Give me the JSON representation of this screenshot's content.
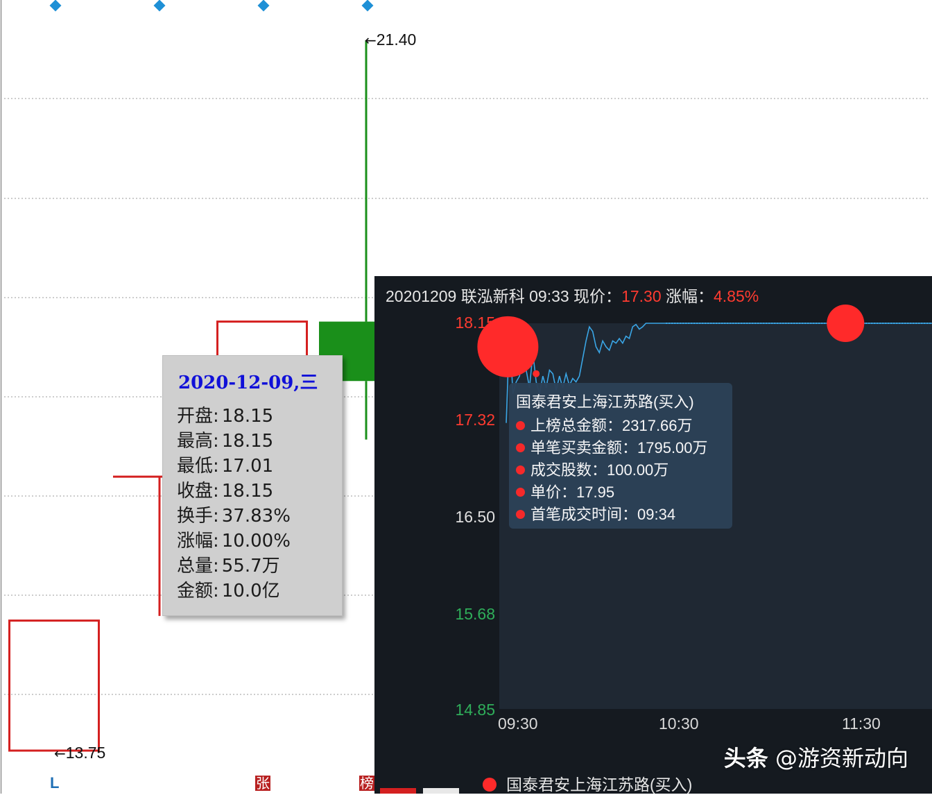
{
  "kline": {
    "chart_data": {
      "type": "candlestick",
      "candles": [
        {
          "name": "candle-1",
          "open": 13.75,
          "close": 15.15,
          "high": 15.15,
          "low": 13.75,
          "color": "#d42020",
          "style": "hollow"
        },
        {
          "name": "candle-2",
          "open": 16.7,
          "close": 16.7,
          "high": 16.7,
          "low": 15.2,
          "color": "#d42020",
          "style": "doji"
        },
        {
          "name": "candle-3",
          "open": 16.9,
          "close": 18.37,
          "high": 18.37,
          "low": 16.7,
          "color": "#d42020",
          "style": "hollow"
        },
        {
          "name": "candle-4",
          "open": 18.37,
          "close": 17.73,
          "high": 21.4,
          "low": 17.1,
          "color": "#1a8f1a",
          "style": "filled"
        }
      ],
      "annotations": {
        "high_label": "21.40",
        "low_label": "13.75"
      },
      "grid": true
    },
    "markers": [
      "张",
      "榜"
    ],
    "bottom_label": "L"
  },
  "ohlc_tooltip": {
    "date": "2020-12-09,三",
    "rows": [
      {
        "label": "开盘:",
        "value": "18.15"
      },
      {
        "label": "最高:",
        "value": "18.15"
      },
      {
        "label": "最低:",
        "value": "17.01"
      },
      {
        "label": "收盘:",
        "value": "18.15"
      },
      {
        "label": "换手:",
        "value": "37.83%"
      },
      {
        "label": "涨幅:",
        "value": "10.00%"
      },
      {
        "label": "总量:",
        "value": "55.7万"
      },
      {
        "label": "金额:",
        "value": "10.0亿"
      }
    ]
  },
  "intraday": {
    "title_prefix": "20201209 联泓新科 09:33 现价：",
    "price": "17.30",
    "change_label": " 涨幅：",
    "change": "4.85%",
    "chart_data": {
      "type": "line",
      "y_ticks": [
        "18.15",
        "17.32",
        "16.50",
        "15.68",
        "14.85"
      ],
      "y_tick_colors": [
        "#ff3b30",
        "#ff3b30",
        "#e0e0e0",
        "#2fae5a",
        "#2fae5a"
      ],
      "ylim": [
        14.85,
        18.15
      ],
      "x_ticks": [
        "09:30",
        "10:30",
        "11:30"
      ],
      "x_minutes": [
        0,
        60,
        120
      ],
      "xlim": [
        0,
        128
      ],
      "line_color": "#3aa6e6",
      "series": [
        {
          "x": [
            0,
            1,
            2,
            3,
            4,
            5,
            6,
            7,
            8,
            9,
            10,
            11,
            12,
            13,
            14,
            15,
            16,
            17,
            18,
            19,
            20,
            21,
            22,
            23,
            24,
            25,
            26,
            27,
            28,
            29,
            30,
            31,
            32,
            33,
            34,
            35,
            36,
            37,
            38,
            39,
            40,
            41,
            42,
            43,
            44,
            45,
            46,
            47,
            48,
            50,
            52,
            54,
            56,
            58,
            60,
            65,
            70,
            75,
            80,
            85,
            90,
            95,
            100,
            105,
            110,
            115,
            120,
            125,
            128
          ],
          "y": [
            17.3,
            18.1,
            17.55,
            17.65,
            17.7,
            17.85,
            17.75,
            17.6,
            17.9,
            17.65,
            17.55,
            17.7,
            17.6,
            17.75,
            17.72,
            17.58,
            17.7,
            17.6,
            17.72,
            17.62,
            17.68,
            17.65,
            17.7,
            17.85,
            18.0,
            18.12,
            18.08,
            17.95,
            17.9,
            18.0,
            17.95,
            17.92,
            18.0,
            17.98,
            18.02,
            17.98,
            18.04,
            18.02,
            18.12,
            18.14,
            18.1,
            18.12,
            18.15,
            18.15,
            18.15,
            18.15,
            18.15,
            18.15,
            18.15,
            18.15,
            18.15,
            18.15,
            18.15,
            18.15,
            18.15,
            18.15,
            18.15,
            18.15,
            18.15,
            18.15,
            18.15,
            18.15,
            18.15,
            18.15,
            18.15,
            18.15,
            18.15,
            18.15,
            18.15
          ]
        }
      ],
      "bubbles": [
        {
          "x": 0.5,
          "y": 17.95,
          "size": "large"
        },
        {
          "x": 102,
          "y": 18.15,
          "size": "medium"
        },
        {
          "x": 9,
          "y": 17.72,
          "size": "small"
        }
      ]
    },
    "buy_tooltip": {
      "head": "国泰君安上海江苏路(买入)",
      "rows": [
        "上榜总金额：2317.66万",
        "单笔买卖金额：1795.00万",
        "成交股数：100.00万",
        "单价：17.95",
        "首笔成交时间：09:34"
      ]
    },
    "legend": "国泰君安上海江苏路(买入)",
    "watermark_bold": "头条",
    "watermark_rest": " @游资新动向"
  }
}
